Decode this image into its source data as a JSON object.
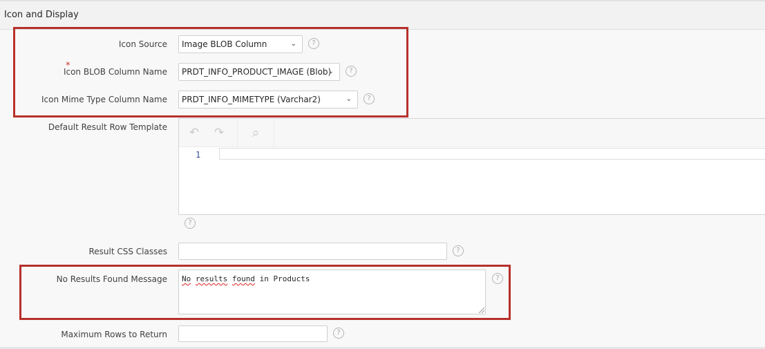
{
  "section": {
    "title": "Icon and Display"
  },
  "fields": {
    "icon_source": {
      "label": "Icon Source",
      "value": "Image BLOB Column"
    },
    "icon_blob_column": {
      "label": "Icon BLOB Column Name",
      "required_marker": "*",
      "value": "PRDT_INFO_PRODUCT_IMAGE (Blob)"
    },
    "icon_mime_column": {
      "label": "Icon Mime Type Column Name",
      "value": "PRDT_INFO_MIMETYPE (Varchar2)"
    },
    "default_result_row_template": {
      "label": "Default Result Row Template",
      "line_number": "1",
      "value": ""
    },
    "result_css_classes": {
      "label": "Result CSS Classes",
      "value": ""
    },
    "no_results_message": {
      "label": "No Results Found Message",
      "value_parts": [
        "No",
        " ",
        "results",
        " ",
        "found",
        " in Products"
      ]
    },
    "max_rows": {
      "label": "Maximum Rows to Return",
      "value": ""
    }
  },
  "icons": {
    "help": "help-circle-icon",
    "chevron": "chevron-down-icon",
    "undo": "undo-icon",
    "redo": "redo-icon",
    "search": "search-icon"
  },
  "glyphs": {
    "help": "?",
    "chevron": "⌄",
    "undo": "↶",
    "redo": "↷",
    "search": "⌕"
  },
  "colors": {
    "highlight_border": "#b7302b",
    "required": "#d0312d",
    "line_number": "#2d4b8e"
  }
}
